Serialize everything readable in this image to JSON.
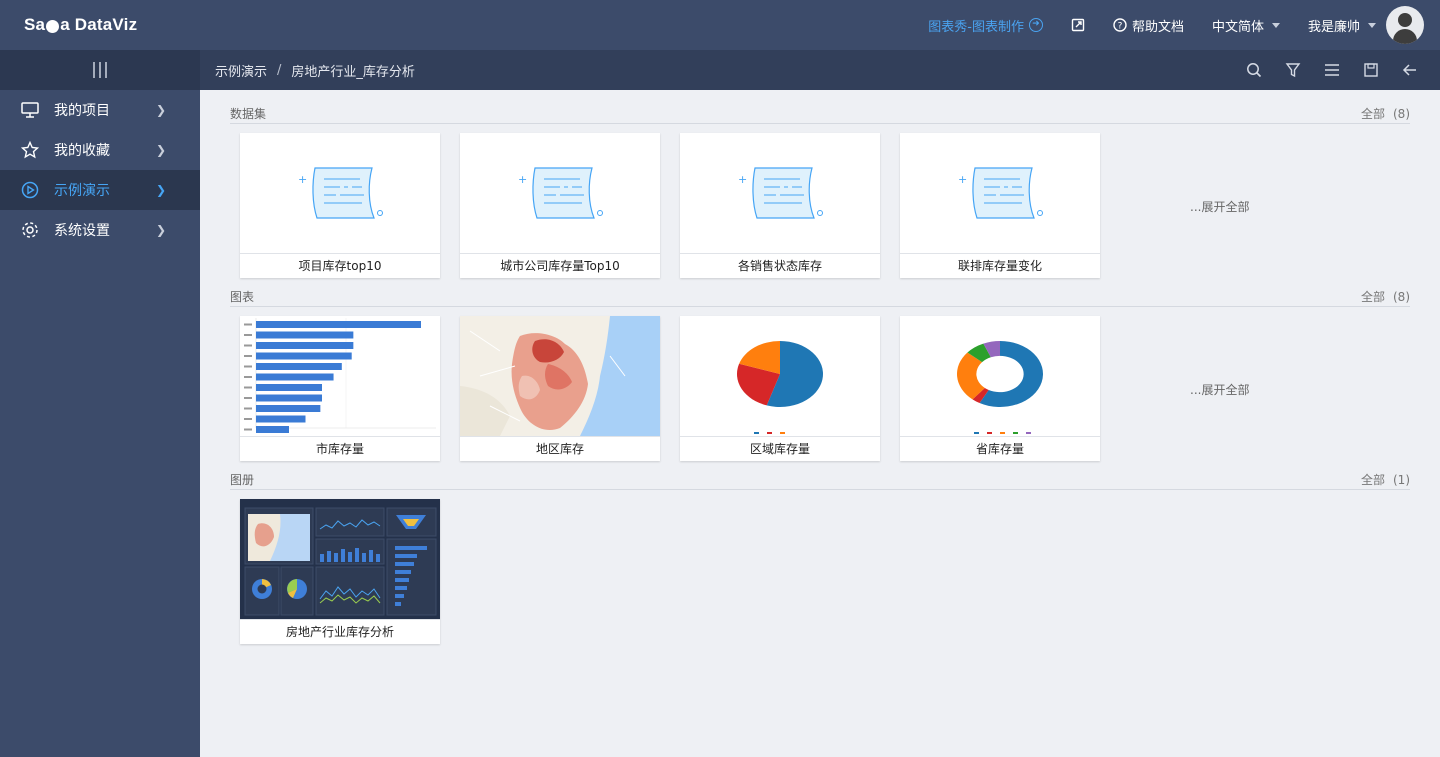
{
  "app": {
    "logo_text_a": "Sa",
    "logo_text_b": "a DataViz"
  },
  "topnav": {
    "showcase_link": "图表秀-图表制作",
    "help": "帮助文档",
    "language": "中文简体",
    "user": "我是廉帅"
  },
  "breadcrumb": {
    "root": "示例演示",
    "sep": "/",
    "current": "房地产行业_库存分析"
  },
  "sidebar": {
    "items": [
      {
        "label": "我的项目",
        "icon": "monitor-icon"
      },
      {
        "label": "我的收藏",
        "icon": "star-icon"
      },
      {
        "label": "示例演示",
        "icon": "play-circle-icon",
        "active": true
      },
      {
        "label": "系统设置",
        "icon": "gear-icon"
      }
    ]
  },
  "sections": {
    "datasets": {
      "title": "数据集",
      "all_label": "全部",
      "count": "(8)",
      "expand": "...展开全部",
      "cards": [
        "项目库存top10",
        "城市公司库存量Top10",
        "各销售状态库存",
        "联排库存量变化"
      ]
    },
    "charts": {
      "title": "图表",
      "all_label": "全部",
      "count": "(8)",
      "expand": "...展开全部",
      "cards": [
        "市库存量",
        "地区库存",
        "区域库存量",
        "省库存量"
      ]
    },
    "albums": {
      "title": "图册",
      "all_label": "全部",
      "count": "(1)",
      "cards": [
        "房地产行业库存分析"
      ]
    }
  },
  "thumb_data": {
    "bar_values": [
      100,
      59,
      59,
      58,
      52,
      47,
      40,
      40,
      39,
      30,
      20
    ],
    "pie_slices": [
      {
        "value": 55,
        "color": "#1f77b4"
      },
      {
        "value": 25,
        "color": "#d62728"
      },
      {
        "value": 20,
        "color": "#ff7f0e"
      }
    ],
    "donut_slices": [
      {
        "value": 55,
        "color": "#1f77b4"
      },
      {
        "value": 3,
        "color": "#d62728"
      },
      {
        "value": 24,
        "color": "#ff7f0e"
      },
      {
        "value": 7,
        "color": "#2ca02c"
      },
      {
        "value": 6,
        "color": "#9467bd"
      }
    ],
    "colors": {
      "accent": "#46a5f5",
      "bar": "#3a7bd5",
      "nav_bg": "#3c4b6a"
    }
  }
}
